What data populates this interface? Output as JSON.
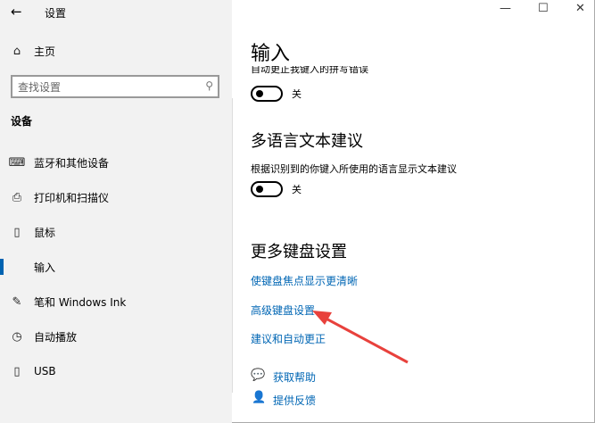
{
  "window": {
    "title": "设置",
    "back_icon": "arrow-left",
    "minimize": "—",
    "maximize": "☐",
    "close": "✕"
  },
  "sidebar": {
    "home": "主页",
    "search_placeholder": "查找设置",
    "section": "设备",
    "items": [
      {
        "label": "蓝牙和其他设备",
        "icon": "bluetooth-devices"
      },
      {
        "label": "打印机和扫描仪",
        "icon": "printer"
      },
      {
        "label": "鼠标",
        "icon": "mouse"
      },
      {
        "label": "输入",
        "icon": "keyboard",
        "selected": true
      },
      {
        "label": "笔和 Windows Ink",
        "icon": "pen"
      },
      {
        "label": "自动播放",
        "icon": "autoplay"
      },
      {
        "label": "USB",
        "icon": "usb"
      }
    ]
  },
  "main": {
    "title": "输入",
    "autocorrect_label": "自动更正我键入的拼写错误",
    "autocorrect_state": "关",
    "multilang_heading": "多语言文本建议",
    "multilang_desc": "根据识别到的你键入所使用的语言显示文本建议",
    "multilang_state": "关",
    "more_heading": "更多键盘设置",
    "links": [
      "使键盘焦点显示更清晰",
      "高级键盘设置",
      "建议和自动更正"
    ],
    "help": "获取帮助",
    "feedback": "提供反馈"
  },
  "annotation_color": "#e8413c"
}
